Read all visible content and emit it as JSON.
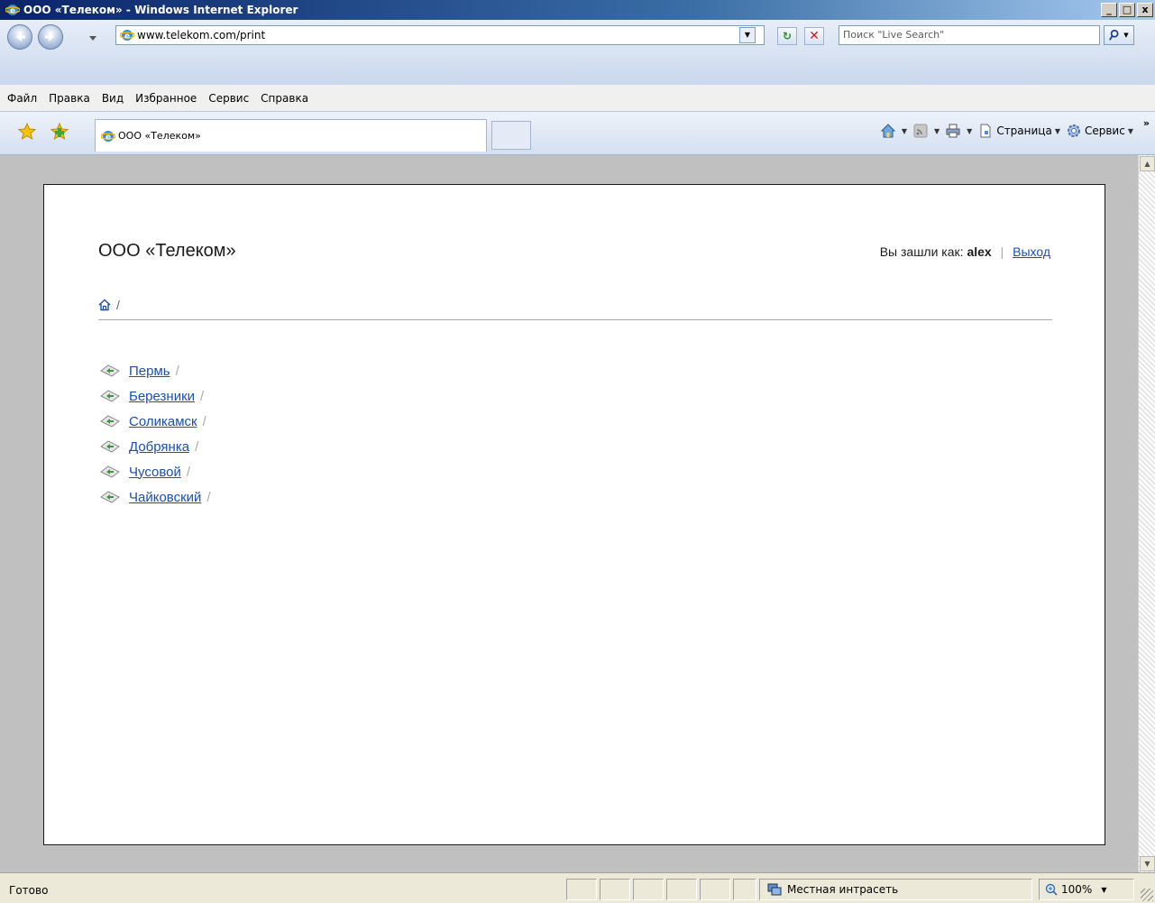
{
  "window": {
    "title": "ООО «Телеком» - Windows Internet Explorer",
    "controls": {
      "minimize": "_",
      "maximize": "□",
      "close": "x"
    }
  },
  "addressbar": {
    "url": "www.telekom.com/print",
    "search_placeholder": "Поиск \"Live Search\""
  },
  "menu": {
    "items": [
      "Файл",
      "Правка",
      "Вид",
      "Избранное",
      "Сервис",
      "Справка"
    ]
  },
  "tabs": {
    "active_tab_label": "ООО «Телеком»"
  },
  "commandbar": {
    "page_label": "Страница",
    "tools_label": "Сервис",
    "overflow": "»"
  },
  "page": {
    "company": "ООО «Телеком»",
    "logged_in_prefix": "Вы зашли как:",
    "username": "alex",
    "separator": "|",
    "logout_label": "Выход",
    "breadcrumb_separator": "/",
    "item_separator": "/",
    "cities": [
      "Пермь",
      "Березники",
      "Соликамск",
      "Добрянка",
      "Чусовой",
      "Чайковский"
    ]
  },
  "statusbar": {
    "status": "Готово",
    "zone": "Местная интрасеть",
    "zoom": "100%"
  },
  "colors": {
    "link": "#1a4fb3",
    "titlebar": "#0a246a",
    "page_border": "#1a1a1a"
  }
}
